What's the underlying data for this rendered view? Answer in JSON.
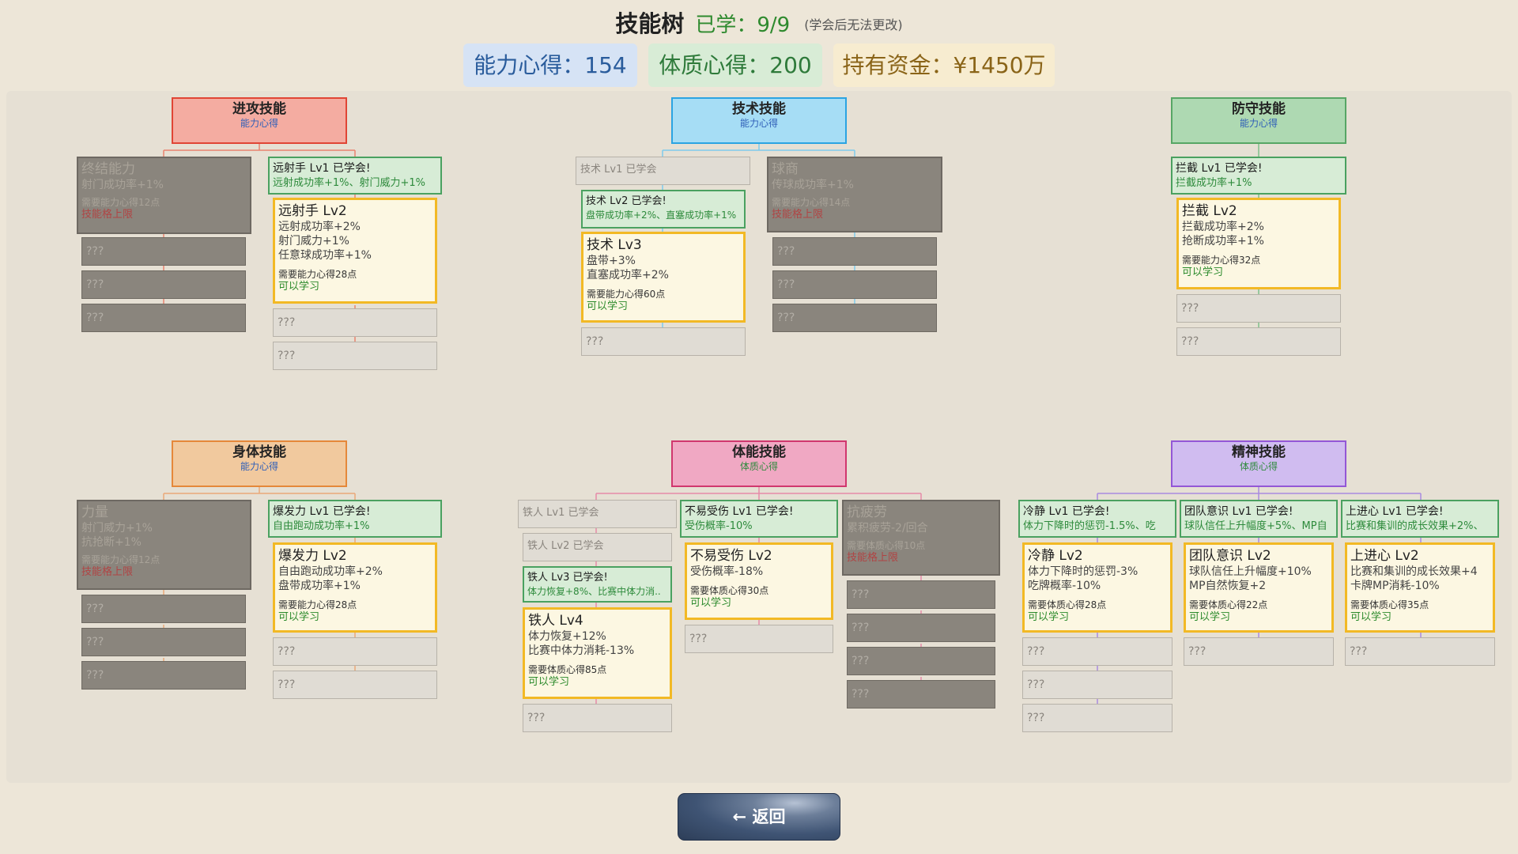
{
  "header": {
    "title": "技能树",
    "learned": "已学：9/9",
    "note": "(学会后无法更改)"
  },
  "stats": {
    "ability": "能力心得：154",
    "physique": "体质心得：200",
    "money": "持有资金：¥1450万"
  },
  "back_label": "← 返回",
  "locked": "???",
  "branches": {
    "attack": {
      "name": "进攻技能",
      "resource": "能力心得",
      "finish": {
        "name": "终结能力",
        "effect": "射门成功率+1%",
        "cost": "需要能力心得12点",
        "status": "技能格上限"
      },
      "lv1": {
        "name": "远射手 Lv1  已学会!",
        "effect": "远射成功率+1%、射门威力+1%"
      },
      "lv2": {
        "name": "远射手 Lv2",
        "effects": [
          "远射成功率+2%",
          "射门威力+1%",
          "任意球成功率+1%"
        ],
        "cost": "需要能力心得28点",
        "status": "可以学习"
      }
    },
    "technique": {
      "name": "技术技能",
      "resource": "能力心得",
      "lv1": "技术 Lv1  已学会",
      "lv2": {
        "name": "技术 Lv2  已学会!",
        "effect": "盘带成功率+2%、直塞成功率+1%"
      },
      "lv3": {
        "name": "技术 Lv3",
        "effects": [
          "盘带+3%",
          "直塞成功率+2%"
        ],
        "cost": "需要能力心得60点",
        "status": "可以学习"
      },
      "iq": {
        "name": "球商",
        "effect": "传球成功率+1%",
        "cost": "需要能力心得14点",
        "status": "技能格上限"
      }
    },
    "defense": {
      "name": "防守技能",
      "resource": "能力心得",
      "lv1": {
        "name": "拦截 Lv1  已学会!",
        "effect": "拦截成功率+1%"
      },
      "lv2": {
        "name": "拦截 Lv2",
        "effects": [
          "拦截成功率+2%",
          "抢断成功率+1%"
        ],
        "cost": "需要能力心得32点",
        "status": "可以学习"
      }
    },
    "body": {
      "name": "身体技能",
      "resource": "能力心得",
      "strength": {
        "name": "力量",
        "effects": [
          "射门威力+1%",
          "抗抢断+1%"
        ],
        "cost": "需要能力心得12点",
        "status": "技能格上限"
      },
      "lv1": {
        "name": "爆发力 Lv1  已学会!",
        "effect": "自由跑动成功率+1%"
      },
      "lv2": {
        "name": "爆发力 Lv2",
        "effects": [
          "自由跑动成功率+2%",
          "盘带成功率+1%"
        ],
        "cost": "需要能力心得28点",
        "status": "可以学习"
      }
    },
    "stamina": {
      "name": "体能技能",
      "resource": "体质心得",
      "iron1": "铁人 Lv1  已学会",
      "iron2": "铁人 Lv2  已学会",
      "iron3": {
        "name": "铁人 Lv3  已学会!",
        "effect": "体力恢复+8%、比赛中体力消.."
      },
      "iron4": {
        "name": "铁人 Lv4",
        "effects": [
          "体力恢复+12%",
          "比赛中体力消耗-13%"
        ],
        "cost": "需要体质心得85点",
        "status": "可以学习"
      },
      "inj1": {
        "name": "不易受伤 Lv1  已学会!",
        "effect": "受伤概率-10%"
      },
      "inj2": {
        "name": "不易受伤 Lv2",
        "effects": [
          "受伤概率-18%"
        ],
        "cost": "需要体质心得30点",
        "status": "可以学习"
      },
      "fatigue": {
        "name": "抗疲劳",
        "effect": "累积疲劳-2/回合",
        "cost": "需要体质心得10点",
        "status": "技能格上限"
      }
    },
    "mental": {
      "name": "精神技能",
      "resource": "体质心得",
      "calm1": {
        "name": "冷静 Lv1  已学会!",
        "effect": "体力下降时的惩罚-1.5%、吃"
      },
      "calm2": {
        "name": "冷静 Lv2",
        "effects": [
          "体力下降时的惩罚-3%",
          "吃牌概率-10%"
        ],
        "cost": "需要体质心得28点",
        "status": "可以学习"
      },
      "team1": {
        "name": "团队意识 Lv1  已学会!",
        "effect": "球队信任上升幅度+5%、MP自"
      },
      "team2": {
        "name": "团队意识 Lv2",
        "effects": [
          "球队信任上升幅度+10%",
          "MP自然恢复+2"
        ],
        "cost": "需要体质心得22点",
        "status": "可以学习"
      },
      "drive1": {
        "name": "上进心 Lv1  已学会!",
        "effect": "比赛和集训的成长效果+2%、"
      },
      "drive2": {
        "name": "上进心 Lv2",
        "effects": [
          "比赛和集训的成长效果+4",
          "卡牌MP消耗-10%"
        ],
        "cost": "需要体质心得35点",
        "status": "可以学习"
      }
    }
  },
  "colors": {
    "learned_green": "#2e8a2e",
    "available_border": "#f2b925",
    "capped_red": "#b04444"
  }
}
